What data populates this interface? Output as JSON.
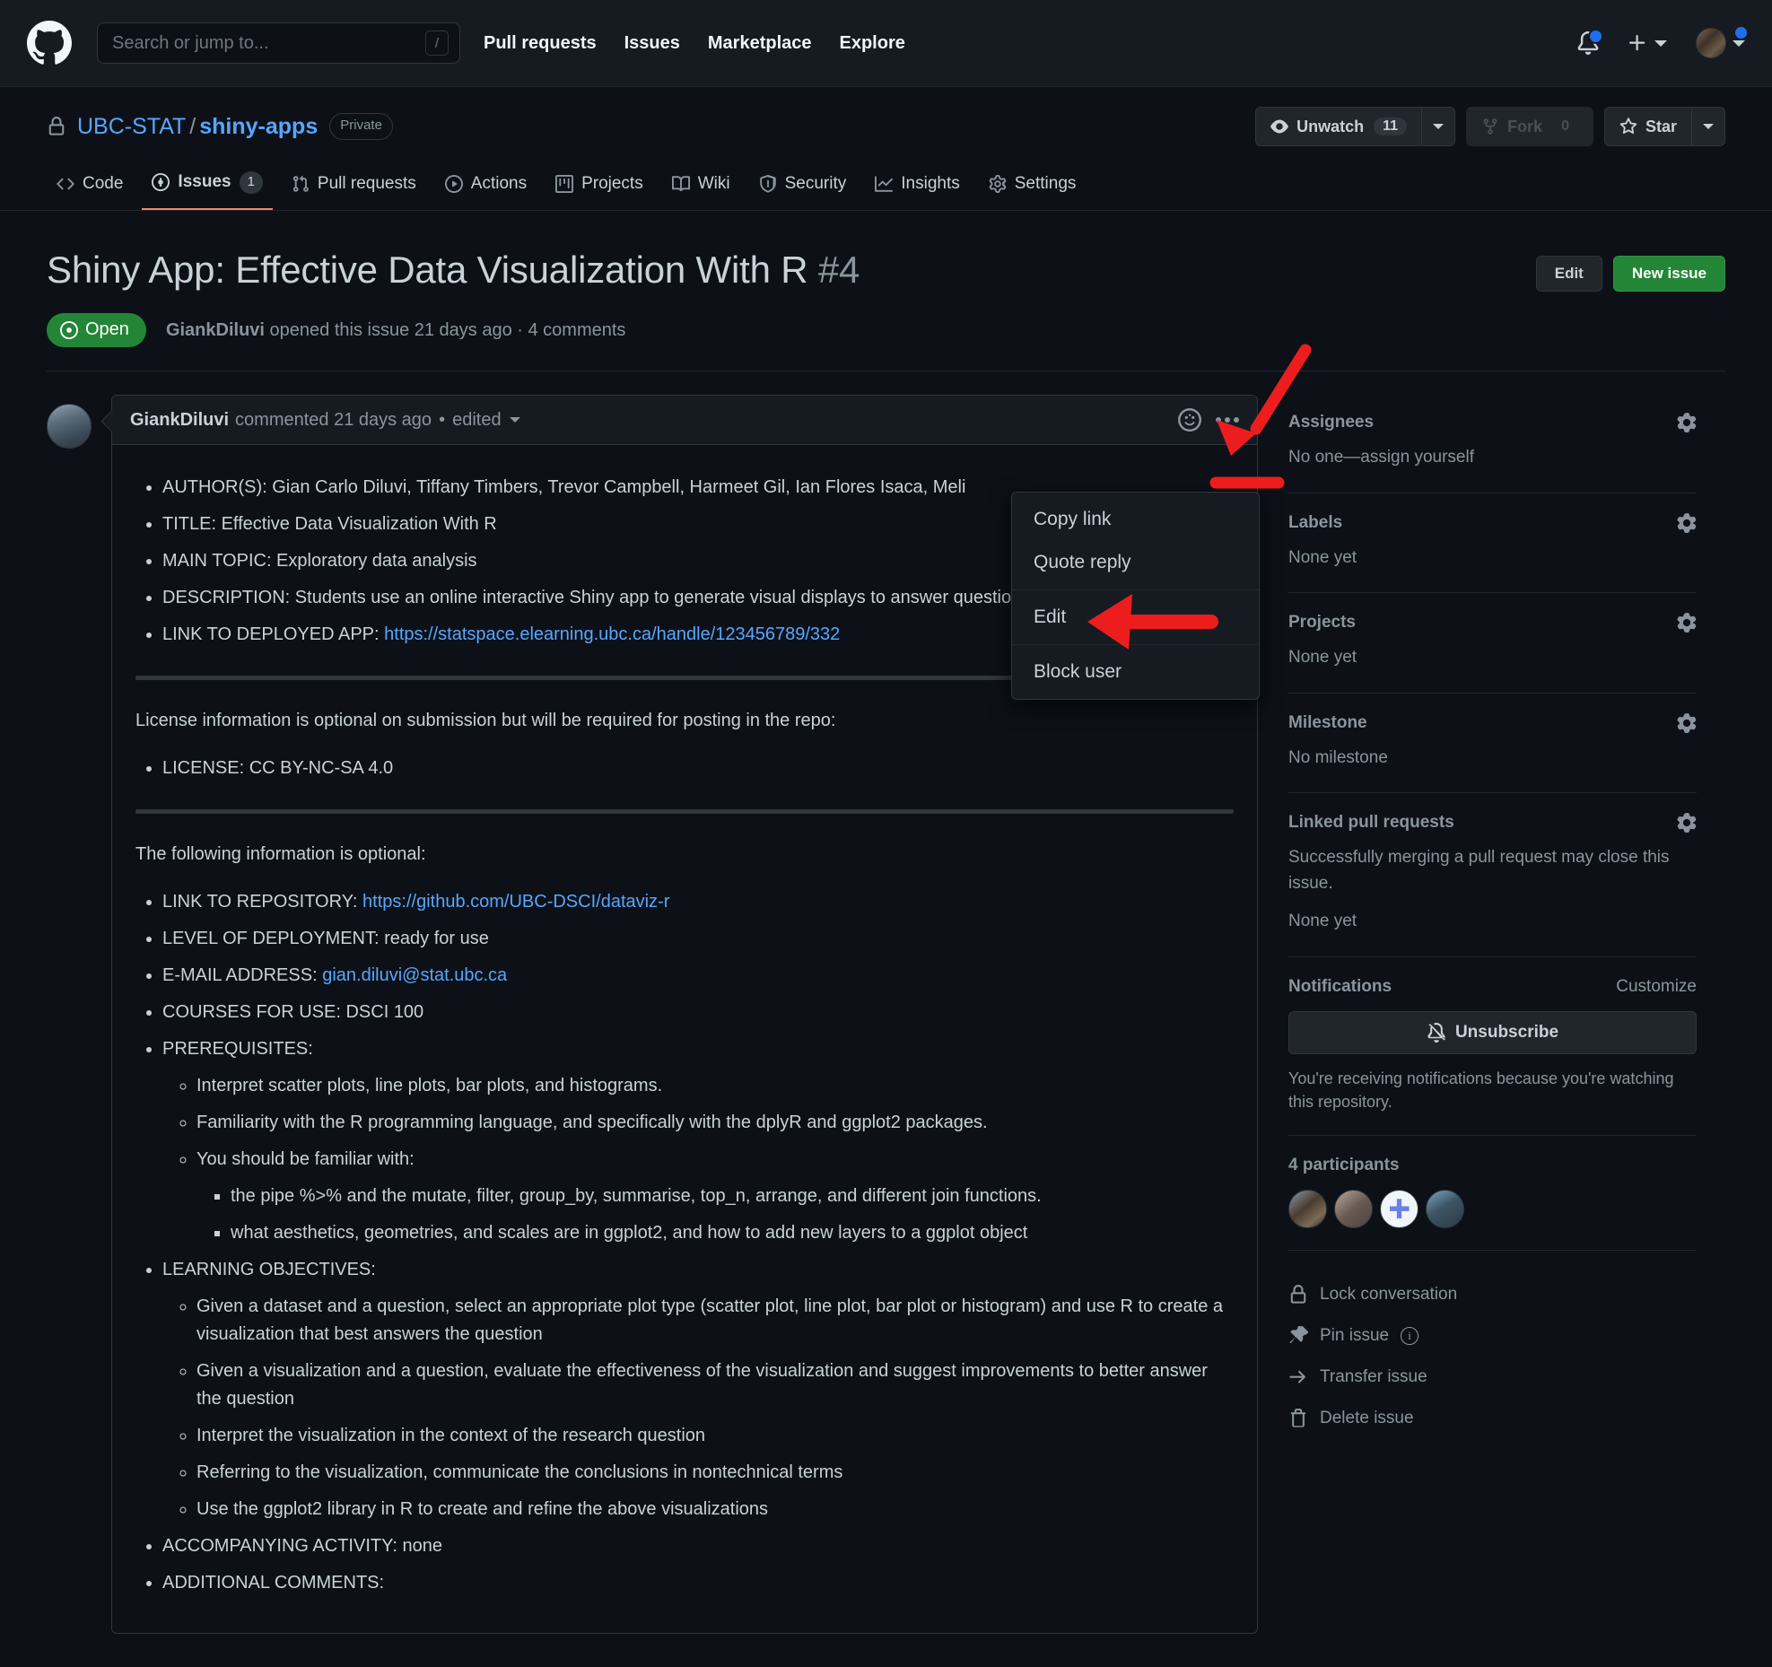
{
  "header": {
    "logo_icon": "github-mark-icon",
    "search": {
      "placeholder": "Search or jump to...",
      "shortcut": "/"
    },
    "nav": [
      {
        "label": "Pull requests"
      },
      {
        "label": "Issues"
      },
      {
        "label": "Marketplace"
      },
      {
        "label": "Explore"
      }
    ],
    "notifications_icon": "bell-icon",
    "create_new_icon": "plus-icon",
    "account_icon": "avatar"
  },
  "repo": {
    "lock_icon": "lock-icon",
    "owner": "UBC-STAT",
    "separator": "/",
    "name": "shiny-apps",
    "visibility": "Private",
    "actions": {
      "watch_label": "Unwatch",
      "watch_count": "11",
      "watch_icon": "eye-icon",
      "fork_label": "Fork",
      "fork_count": "0",
      "fork_icon": "repo-forked-icon",
      "star_label": "Star",
      "star_icon": "star-icon"
    },
    "tabs": [
      {
        "label": "Code",
        "icon": "code-icon",
        "counter": null,
        "selected": false
      },
      {
        "label": "Issues",
        "icon": "issue-opened-icon",
        "counter": "1",
        "selected": true
      },
      {
        "label": "Pull requests",
        "icon": "git-pull-request-icon",
        "counter": null,
        "selected": false
      },
      {
        "label": "Actions",
        "icon": "play-icon",
        "counter": null,
        "selected": false
      },
      {
        "label": "Projects",
        "icon": "project-icon",
        "counter": null,
        "selected": false
      },
      {
        "label": "Wiki",
        "icon": "book-icon",
        "counter": null,
        "selected": false
      },
      {
        "label": "Security",
        "icon": "shield-icon",
        "counter": null,
        "selected": false
      },
      {
        "label": "Insights",
        "icon": "graph-icon",
        "counter": null,
        "selected": false
      },
      {
        "label": "Settings",
        "icon": "gear-icon",
        "counter": null,
        "selected": false
      }
    ]
  },
  "issue": {
    "title": "Shiny App: Effective Data Visualization With R",
    "number": "#4",
    "edit_label": "Edit",
    "new_issue_label": "New issue",
    "state": "Open",
    "state_icon": "issue-opened-icon",
    "meta_author": "GiankDiluvi",
    "meta_text": " opened this issue 21 days ago · 4 comments"
  },
  "comment": {
    "author": "GiankDiluvi",
    "meta": "commented 21 days ago",
    "separator": "•",
    "edited_label": "edited",
    "reaction_icon": "smiley-icon",
    "kebab_icon": "kebab-horizontal-icon",
    "body": {
      "bullets_main": [
        "AUTHOR(S): Gian Carlo Diluvi, Tiffany Timbers, Trevor Campbell, Harmeet Gil, Ian Flores Isaca, Meli",
        "TITLE: Effective Data Visualization With R",
        "MAIN TOPIC: Exploratory data analysis",
        "DESCRIPTION: Students use an online interactive Shiny app to generate visual displays to answer questions for two case studies"
      ],
      "deployed_label": "LINK TO DEPLOYED APP: ",
      "deployed_link": "https://statspace.elearning.ubc.ca/handle/123456789/332",
      "license_intro": "License information is optional on submission but will be required for posting in the repo:",
      "license_item": "LICENSE: CC BY-NC-SA 4.0",
      "optional_intro": "The following information is optional:",
      "repo_label": "LINK TO REPOSITORY: ",
      "repo_link": "https://github.com/UBC-DSCI/dataviz-r",
      "deployment_level": "LEVEL OF DEPLOYMENT: ready for use",
      "email_label": "E-MAIL ADDRESS: ",
      "email_link": "gian.diluvi@stat.ubc.ca",
      "courses": "COURSES FOR USE: DSCI 100",
      "prerequisites_label": "PREREQUISITES:",
      "prerequisites": [
        "Interpret scatter plots, line plots, bar plots, and histograms.",
        "Familiarity with the R programming language, and specifically with the dplyR and ggplot2 packages.",
        "You should be familiar with:"
      ],
      "familiar_sub": [
        "the pipe %>% and the mutate, filter, group_by, summarise, top_n, arrange, and different join functions.",
        "what aesthetics, geometries, and scales are in ggplot2, and how to add new layers to a ggplot object"
      ],
      "objectives_label": "LEARNING OBJECTIVES:",
      "objectives": [
        "Given a dataset and a question, select an appropriate plot type (scatter plot, line plot, bar plot or histogram) and use R to create a visualization that best answers the question",
        "Given a visualization and a question, evaluate the effectiveness of the visualization and suggest improvements to better answer the question",
        "Interpret the visualization in the context of the research question",
        "Referring to the visualization, communicate the conclusions in nontechnical terms",
        "Use the ggplot2 library in R to create and refine the above visualizations"
      ],
      "accompanying": "ACCOMPANYING ACTIVITY: none",
      "additional": "ADDITIONAL COMMENTS:"
    }
  },
  "dropdown": {
    "items": [
      {
        "label": "Copy link",
        "separator_after": false
      },
      {
        "label": "Quote reply",
        "separator_after": true
      },
      {
        "label": "Edit",
        "separator_after": true
      },
      {
        "label": "Block user",
        "separator_after": false
      }
    ]
  },
  "sidebar": {
    "assignees": {
      "title": "Assignees",
      "body": "No one—assign yourself",
      "gear_icon": "gear-icon"
    },
    "labels": {
      "title": "Labels",
      "body": "None yet",
      "gear_icon": "gear-icon"
    },
    "projects": {
      "title": "Projects",
      "body": "None yet",
      "gear_icon": "gear-icon"
    },
    "milestone": {
      "title": "Milestone",
      "body": "No milestone",
      "gear_icon": "gear-icon"
    },
    "linked_prs": {
      "title": "Linked pull requests",
      "body": "Successfully merging a pull request may close this issue.",
      "body2": "None yet",
      "gear_icon": "gear-icon"
    },
    "notifications": {
      "title": "Notifications",
      "customize": "Customize",
      "button_label": "Unsubscribe",
      "button_icon": "bell-slash-icon",
      "note": "You're receiving notifications because you're watching this repository."
    },
    "participants": {
      "title": "4 participants",
      "count": 4
    },
    "actions": [
      {
        "label": "Lock conversation",
        "icon": "lock-icon",
        "has_info": false
      },
      {
        "label": "Pin issue",
        "icon": "pin-icon",
        "has_info": true
      },
      {
        "label": "Transfer issue",
        "icon": "arrow-right-icon",
        "has_info": false
      },
      {
        "label": "Delete issue",
        "icon": "trash-icon",
        "has_info": false
      }
    ]
  },
  "colors": {
    "page_bg": "#0d1117",
    "header_bg": "#161b22",
    "accent_blue": "#58a6ff",
    "open_green": "#238636",
    "selected_tab": "#f78166",
    "annotation_red": "#ee1d1d"
  }
}
